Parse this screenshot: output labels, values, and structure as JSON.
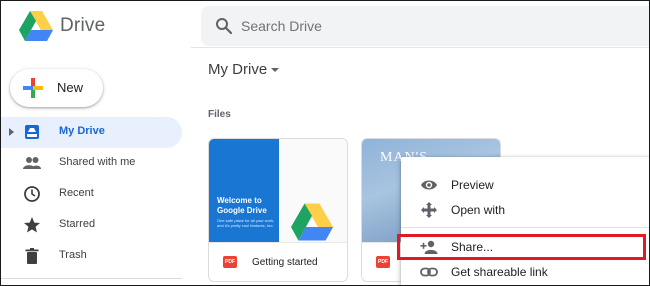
{
  "app": {
    "brand": "Drive"
  },
  "search": {
    "placeholder": "Search Drive"
  },
  "new_button": {
    "label": "New"
  },
  "sidebar": {
    "items": [
      {
        "label": "My Drive",
        "icon": "my-drive-icon",
        "active": true
      },
      {
        "label": "Shared with me",
        "icon": "people-icon"
      },
      {
        "label": "Recent",
        "icon": "clock-icon"
      },
      {
        "label": "Starred",
        "icon": "star-icon"
      },
      {
        "label": "Trash",
        "icon": "trash-icon"
      }
    ]
  },
  "main": {
    "title": "My Drive",
    "section": "Files",
    "files": [
      {
        "name": "Getting started",
        "type_badge": "PDF",
        "thumb_title": "Welcome to Google Drive",
        "thumb_sub": "One safe place for all your work, and it's pretty cool features, too."
      },
      {
        "name": "",
        "type_badge": "PDF",
        "thumb_title": "MAN'S"
      }
    ]
  },
  "context_menu": {
    "items": [
      {
        "label": "Preview",
        "icon": "eye-icon"
      },
      {
        "label": "Open with",
        "icon": "move-arrows-icon"
      },
      {
        "label": "Share...",
        "icon": "person-add-icon"
      },
      {
        "label": "Get shareable link",
        "icon": "link-icon"
      }
    ]
  },
  "colors": {
    "accent": "#1967d2",
    "active_bg": "#e8f0fe",
    "highlight": "#e01a23",
    "pdf": "#ea4335"
  }
}
